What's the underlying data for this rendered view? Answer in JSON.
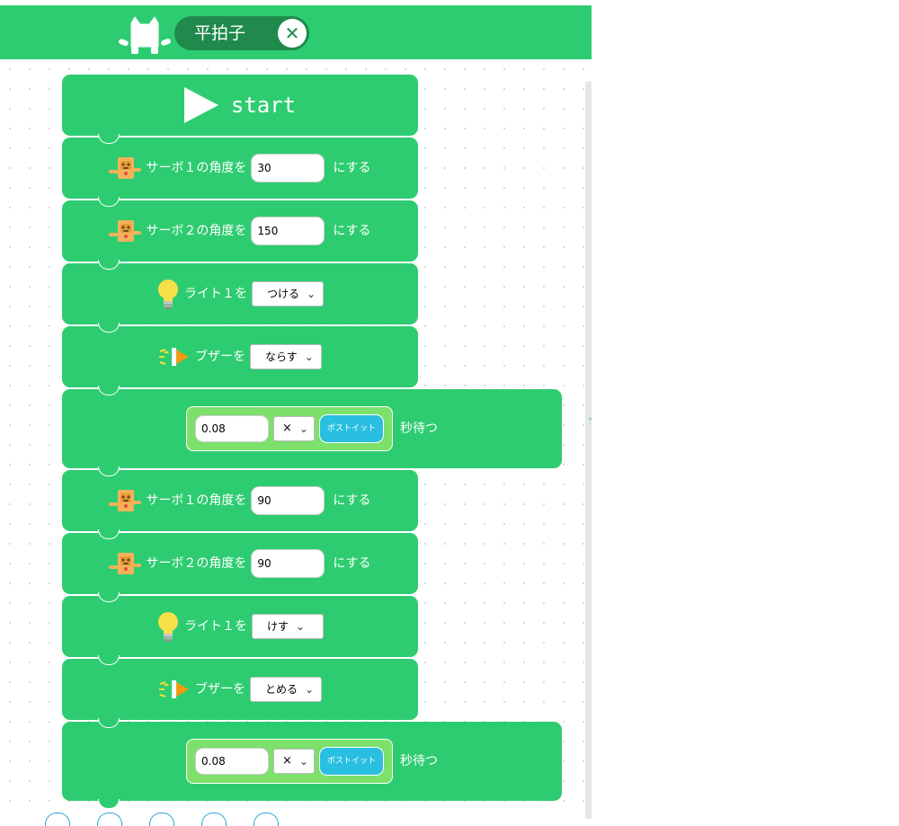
{
  "header": {
    "title": "平拍子",
    "close_label": "✕"
  },
  "program": {
    "start_label": "start",
    "blocks": [
      {
        "type": "servo",
        "prefix": "サーボ１の角度を",
        "value": "30",
        "suffix": "にする"
      },
      {
        "type": "servo",
        "prefix": "サーボ２の角度を",
        "value": "150",
        "suffix": "にする"
      },
      {
        "type": "light",
        "prefix": "ライト１を",
        "selected": "つける"
      },
      {
        "type": "buzzer",
        "prefix": "ブザーを",
        "selected": "ならす"
      },
      {
        "type": "wait",
        "value": "0.08",
        "operator": "×",
        "button": "ポストイット",
        "suffix": "秒待つ"
      },
      {
        "type": "servo",
        "prefix": "サーボ１の角度を",
        "value": "90",
        "suffix": "にする"
      },
      {
        "type": "servo",
        "prefix": "サーボ２の角度を",
        "value": "90",
        "suffix": "にする"
      },
      {
        "type": "light",
        "prefix": "ライト１を",
        "selected": "けす"
      },
      {
        "type": "buzzer",
        "prefix": "ブザーを",
        "selected": "とめる"
      },
      {
        "type": "wait",
        "value": "0.08",
        "operator": "×",
        "button": "ポストイット",
        "suffix": "秒待つ"
      }
    ]
  },
  "icons": {
    "cat": "cat-icon",
    "play": "play-icon",
    "servo": "servo-robot-icon",
    "light": "light-bulb-icon",
    "buzzer": "buzzer-icon",
    "chevron": "chevron-down-icon"
  },
  "colors": {
    "block": "#2ecc71",
    "header": "#2ecc71",
    "title_pill": "#1f8a4c",
    "wait_box": "#7ce06b",
    "postit": "#29bfe0"
  }
}
